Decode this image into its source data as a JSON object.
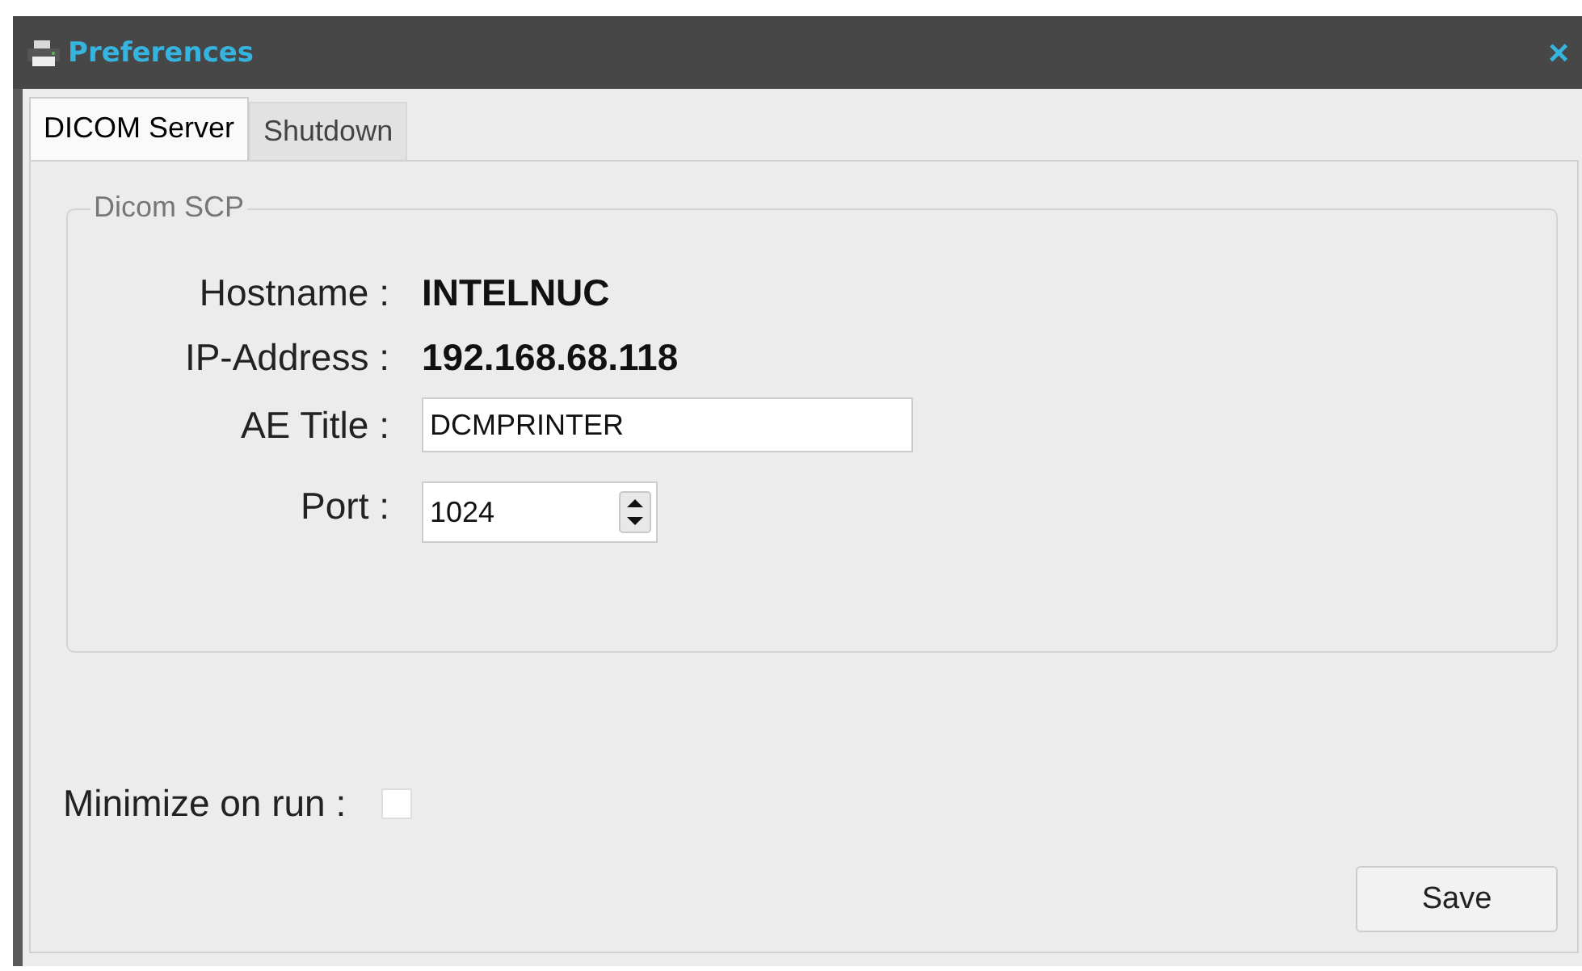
{
  "window": {
    "title": "Preferences",
    "close": "×"
  },
  "tabs": [
    {
      "label": "DICOM Server",
      "selected": true
    },
    {
      "label": "Shutdown",
      "selected": false
    }
  ],
  "group": {
    "title": "Dicom SCP",
    "rows": [
      {
        "kind": "text",
        "label": "Hostname :",
        "value": "INTELNUC"
      },
      {
        "kind": "text",
        "label": "IP-Address :",
        "value": "192.168.68.118"
      },
      {
        "kind": "input",
        "label": "AE Title :",
        "value": "DCMPRINTER"
      },
      {
        "kind": "spin",
        "label": "Port :",
        "value": "1024"
      }
    ]
  },
  "minimize": {
    "label": "Minimize on run :",
    "checked": false
  },
  "buttons": [
    "Save"
  ]
}
